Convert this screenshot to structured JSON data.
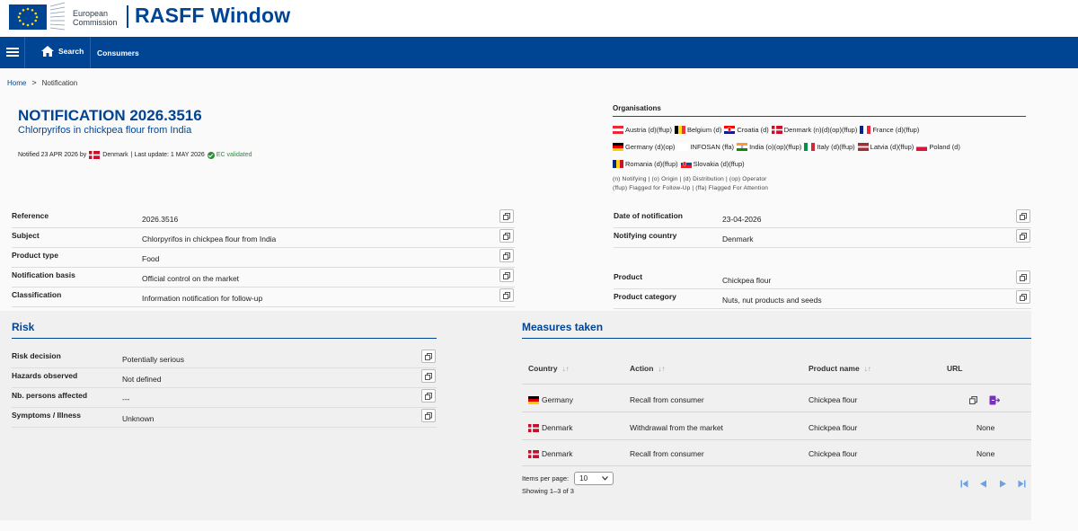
{
  "header": {
    "ec_line1": "European",
    "ec_line2": "Commission",
    "app_title": "RASFF Window"
  },
  "nav": {
    "home_label": "Search",
    "consumers_label": "Consumers"
  },
  "breadcrumb": {
    "home": "Home",
    "separator": ">",
    "current": "Notification"
  },
  "notification": {
    "title": "NOTIFICATION 2026.3516",
    "subtitle": "Chlorpyrifos in chickpea flour from India",
    "meta_prefix": "Notified 23 APR 2026 by",
    "meta_country": "Denmark",
    "meta_update": "| Last update: 1 MAY 2026",
    "validated": "EC validated"
  },
  "organisations": {
    "title": "Organisations",
    "items": [
      {
        "label": "Austria (d)(ffup)",
        "flag": "austria"
      },
      {
        "label": "Belgium (d)",
        "flag": "belgium"
      },
      {
        "label": "Croatia (d)",
        "flag": "croatia"
      },
      {
        "label": "Denmark (n)(d)(op)(ffup)",
        "flag": "denmark"
      },
      {
        "label": "France (d)(ffup)",
        "flag": "france"
      },
      {
        "label": "Germany (d)(op)",
        "flag": "germany"
      },
      {
        "label": "INFOSAN (ffa)",
        "flag": "none"
      },
      {
        "label": "India (o)(op)(ffup)",
        "flag": "india"
      },
      {
        "label": "Italy (d)(ffup)",
        "flag": "italy"
      },
      {
        "label": "Latvia (d)(ffup)",
        "flag": "latvia"
      },
      {
        "label": "Poland (d)",
        "flag": "poland"
      },
      {
        "label": "Romania (d)(ffup)",
        "flag": "romania"
      },
      {
        "label": "Slovakia (d)(ffup)",
        "flag": "slovakia"
      }
    ],
    "legend_line1": "(n) Notifying | (o) Origin | (d) Distribution | (op) Operator",
    "legend_line2": "(ffup) Flagged for Follow-Up | (ffa) Flagged For Attention"
  },
  "details_left": [
    {
      "label": "Reference",
      "value": "2026.3516"
    },
    {
      "label": "Subject",
      "value": "Chlorpyrifos in chickpea flour from India"
    },
    {
      "label": "Product type",
      "value": "Food"
    },
    {
      "label": "Notification basis",
      "value": "Official control on the market"
    },
    {
      "label": "Classification",
      "value": "Information notification for follow-up"
    }
  ],
  "details_right": [
    {
      "label": "Date of notification",
      "value": "23-04-2026"
    },
    {
      "label": "Notifying country",
      "value": "Denmark"
    },
    {
      "label": "Product",
      "value": "Chickpea flour"
    },
    {
      "label": "Product category",
      "value": "Nuts, nut products and seeds"
    }
  ],
  "risk": {
    "title": "Risk",
    "rows": [
      {
        "label": "Risk decision",
        "value": "Potentially serious"
      },
      {
        "label": "Hazards observed",
        "value": "Not defined"
      },
      {
        "label": "Nb. persons affected",
        "value": "---"
      },
      {
        "label": "Symptoms / Illness",
        "value": "Unknown"
      }
    ]
  },
  "measures": {
    "title": "Measures taken",
    "columns": {
      "country": "Country",
      "action": "Action",
      "product": "Product name",
      "url": "URL"
    },
    "rows": [
      {
        "country": "Germany",
        "flag": "germany",
        "action": "Recall from consumer",
        "product": "Chickpea flour",
        "url": ""
      },
      {
        "country": "Denmark",
        "flag": "denmark",
        "action": "Withdrawal from the market",
        "product": "Chickpea flour",
        "url": "None"
      },
      {
        "country": "Denmark",
        "flag": "denmark",
        "action": "Recall from consumer",
        "product": "Chickpea flour",
        "url": "None"
      }
    ],
    "items_per_page_label": "Items per page:",
    "items_per_page_value": "10",
    "showing": "Showing 1–3 of 3"
  },
  "colors": {
    "brand_blue": "#004494",
    "validated_green": "#2e8b3e",
    "pager_blue": "#6aa0e6"
  }
}
